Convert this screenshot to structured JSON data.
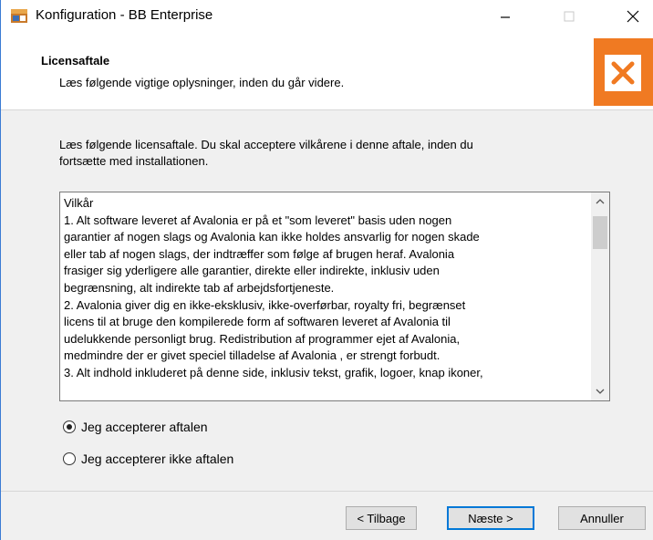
{
  "window": {
    "title": "Konfiguration - BB Enterprise",
    "accent_color": "#f07a22"
  },
  "header": {
    "title": "Licensaftale",
    "subtitle": "Læs følgende vigtige oplysninger, inden du går videre."
  },
  "intro_lines": [
    "Læs følgende licensaftale. Du skal acceptere vilkårene i denne aftale, inden du",
    "fortsætte med installationen."
  ],
  "license_lines": [
    "Vilkår",
    "1. Alt software leveret af Avalonia er på et \"som leveret\" basis uden nogen",
    "garantier af nogen slags og Avalonia kan ikke holdes ansvarlig for nogen skade",
    "eller tab af nogen slags, der indtræffer som følge af brugen heraf. Avalonia",
    "frasiger sig yderligere alle garantier, direkte eller indirekte, inklusiv uden",
    "begrænsning, alt indirekte tab af arbejdsfortjeneste.",
    "2. Avalonia giver dig en ikke-eksklusiv, ikke-overførbar, royalty fri, begrænset",
    "licens til at bruge den kompilerede form af softwaren leveret af  Avalonia til",
    "udelukkende personligt brug. Redistribution af programmer ejet af  Avalonia,",
    "medmindre der er givet speciel tilladelse af Avalonia , er strengt forbudt.",
    "3. Alt indhold inkluderet på denne side, inklusiv tekst, grafik, logoer, knap ikoner,"
  ],
  "options": {
    "accept": "Jeg accepterer aftalen",
    "decline": "Jeg accepterer ikke aftalen",
    "selected": "accept"
  },
  "buttons": {
    "back": "< Tilbage",
    "next": "Næste >",
    "cancel": "Annuller"
  }
}
